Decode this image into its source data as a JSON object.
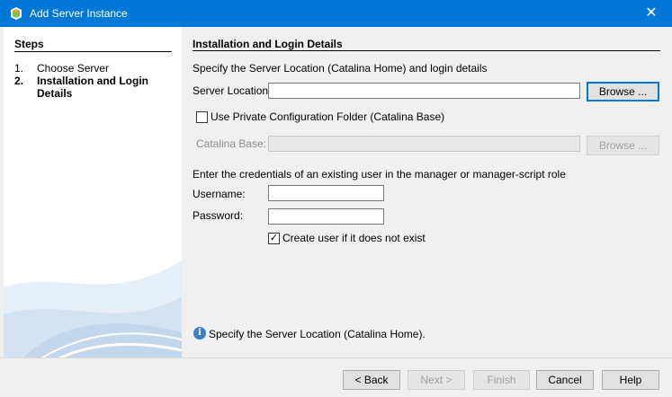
{
  "window": {
    "title": "Add Server Instance",
    "close_glyph": "✕"
  },
  "steps": {
    "header": "Steps",
    "items": [
      {
        "num": "1.",
        "label": "Choose Server"
      },
      {
        "num": "2.",
        "label": "Installation and Login Details"
      }
    ]
  },
  "panel": {
    "title": "Installation and Login Details",
    "intro": "Specify the Server Location (Catalina Home) and login details",
    "server_location_label": "Server Location:",
    "server_location_value": "",
    "browse_label": "Browse ...",
    "private_config_label": "Use Private Configuration Folder (Catalina Base)",
    "private_config_checked": false,
    "catalina_base_label": "Catalina Base:",
    "catalina_base_value": "",
    "browse_disabled_label": "Browse ...",
    "credentials_intro": "Enter the credentials of an existing user in the manager or manager-script role",
    "username_label": "Username:",
    "username_value": "",
    "password_label": "Password:",
    "password_value": "",
    "create_user_label": "Create user if it does not exist",
    "create_user_checked": true,
    "check_glyph": "✓",
    "info_glyph": "i",
    "info_text": "Specify the Server Location (Catalina Home)."
  },
  "buttons": {
    "back": "< Back",
    "next": "Next >",
    "finish": "Finish",
    "cancel": "Cancel",
    "help": "Help"
  },
  "colors": {
    "accent": "#0078d7",
    "info": "#3b7fc4"
  },
  "icons": [
    "app-icon",
    "close-icon",
    "checkbox-icon",
    "info-icon"
  ]
}
